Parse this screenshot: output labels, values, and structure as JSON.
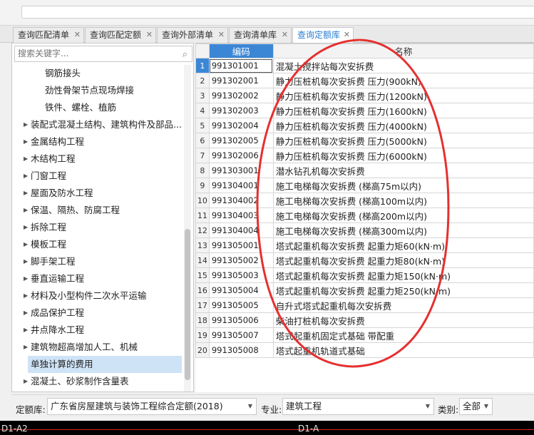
{
  "tabs": [
    {
      "label": "查询匹配清单",
      "active": false
    },
    {
      "label": "查询匹配定额",
      "active": false
    },
    {
      "label": "查询外部清单",
      "active": false
    },
    {
      "label": "查询清单库",
      "active": false
    },
    {
      "label": "查询定额库",
      "active": true
    }
  ],
  "search": {
    "placeholder": "搜索关键字..."
  },
  "tree": [
    {
      "label": "钢筋接头",
      "leaf": true
    },
    {
      "label": "劲性骨架节点现场焊接",
      "leaf": true
    },
    {
      "label": "铁件、螺栓、植筋",
      "leaf": true
    },
    {
      "label": "装配式混凝土结构、建筑构件及部品...",
      "leaf": false
    },
    {
      "label": "金属结构工程",
      "leaf": false
    },
    {
      "label": "木结构工程",
      "leaf": false
    },
    {
      "label": "门窗工程",
      "leaf": false
    },
    {
      "label": "屋面及防水工程",
      "leaf": false
    },
    {
      "label": "保温、隔热、防腐工程",
      "leaf": false
    },
    {
      "label": "拆除工程",
      "leaf": false
    },
    {
      "label": "模板工程",
      "leaf": false
    },
    {
      "label": "脚手架工程",
      "leaf": false
    },
    {
      "label": "垂直运输工程",
      "leaf": false
    },
    {
      "label": "材料及小型构件二次水平运输",
      "leaf": false
    },
    {
      "label": "成品保护工程",
      "leaf": false
    },
    {
      "label": "井点降水工程",
      "leaf": false
    },
    {
      "label": "建筑物超高增加人工、机械",
      "leaf": false
    },
    {
      "label": "单独计算的费用",
      "leaf": true,
      "selected": true
    },
    {
      "label": "混凝土、砂浆制作含量表",
      "leaf": false
    }
  ],
  "grid": {
    "headers": {
      "code": "编码",
      "name": "名称"
    },
    "rows": [
      {
        "n": "1",
        "code": "991301001",
        "name": "混凝土搅拌站每次安拆费"
      },
      {
        "n": "2",
        "code": "991302001",
        "name": "静力压桩机每次安拆费 压力(900kN)"
      },
      {
        "n": "3",
        "code": "991302002",
        "name": "静力压桩机每次安拆费 压力(1200kN)"
      },
      {
        "n": "4",
        "code": "991302003",
        "name": "静力压桩机每次安拆费 压力(1600kN)"
      },
      {
        "n": "5",
        "code": "991302004",
        "name": "静力压桩机每次安拆费 压力(4000kN)"
      },
      {
        "n": "6",
        "code": "991302005",
        "name": "静力压桩机每次安拆费 压力(5000kN)"
      },
      {
        "n": "7",
        "code": "991302006",
        "name": "静力压桩机每次安拆费 压力(6000kN)"
      },
      {
        "n": "8",
        "code": "991303001",
        "name": "潜水钻孔机每次安拆费"
      },
      {
        "n": "9",
        "code": "991304001",
        "name": "施工电梯每次安拆费 (梯高75m以内)"
      },
      {
        "n": "10",
        "code": "991304002",
        "name": "施工电梯每次安拆费 (梯高100m以内)"
      },
      {
        "n": "11",
        "code": "991304003",
        "name": "施工电梯每次安拆费 (梯高200m以内)"
      },
      {
        "n": "12",
        "code": "991304004",
        "name": "施工电梯每次安拆费 (梯高300m以内)"
      },
      {
        "n": "13",
        "code": "991305001",
        "name": "塔式起重机每次安拆费 起重力矩60(kN·m)"
      },
      {
        "n": "14",
        "code": "991305002",
        "name": "塔式起重机每次安拆费 起重力矩80(kN·m)"
      },
      {
        "n": "15",
        "code": "991305003",
        "name": "塔式起重机每次安拆费 起重力矩150(kN·m)"
      },
      {
        "n": "16",
        "code": "991305004",
        "name": "塔式起重机每次安拆费 起重力矩250(kN·m)"
      },
      {
        "n": "17",
        "code": "991305005",
        "name": "自升式塔式起重机每次安拆费"
      },
      {
        "n": "18",
        "code": "991305006",
        "name": "柴油打桩机每次安拆费"
      },
      {
        "n": "19",
        "code": "991305007",
        "name": "塔式起重机固定式基础 带配重"
      },
      {
        "n": "20",
        "code": "991305008",
        "name": "塔式起重机轨道式基础"
      }
    ]
  },
  "filters": {
    "quota_label": "定额库:",
    "quota_value": "广东省房屋建筑与装饰工程综合定额(2018)",
    "major_label": "专业:",
    "major_value": "建筑工程",
    "category_label": "类别:",
    "category_value": "全部"
  },
  "cad": {
    "label_left": "D1-A2",
    "label_mid": "D1-A"
  },
  "colors": {
    "accent": "#3b87d6",
    "annotation": "#e53030",
    "selected_row": "#cfe3f7"
  }
}
